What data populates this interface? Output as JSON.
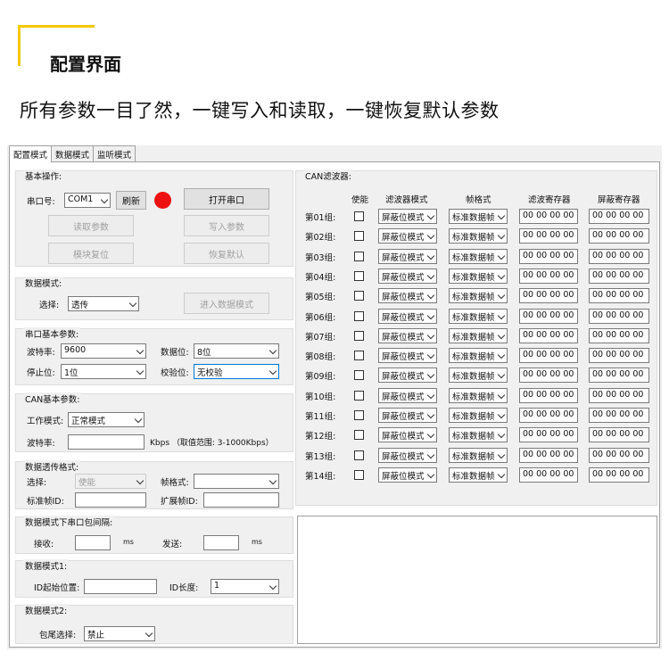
{
  "header": {
    "title": "配置界面",
    "subtitle": "所有参数一目了然，一键写入和读取，一键恢复默认参数"
  },
  "colors": {
    "accent": "#f5c800",
    "indicator": "#ee1111"
  },
  "tabs": [
    "配置模式",
    "数据模式",
    "监听模式"
  ],
  "basic_ops": {
    "label": "基本操作:",
    "port_label": "串口号:",
    "port_value": "COM1",
    "refresh": "刷新",
    "open_port": "打开串口",
    "read_params": "读取参数",
    "write_params": "写入参数",
    "module_reset": "模块复位",
    "restore_default": "恢复默认"
  },
  "data_mode": {
    "label": "数据模式:",
    "select_label": "选择:",
    "select_value": "透传",
    "enter_button": "进入数据模式"
  },
  "serial_params": {
    "label": "串口基本参数:",
    "baud_label": "波特率:",
    "baud_value": "9600",
    "databits_label": "数据位:",
    "databits_value": "8位",
    "stopbits_label": "停止位:",
    "stopbits_value": "1位",
    "parity_label": "校验位:",
    "parity_value": "无校验"
  },
  "can_params": {
    "label": "CAN基本参数:",
    "workmode_label": "工作模式:",
    "workmode_value": "正常模式",
    "baud_label": "波特率:",
    "baud_value": "",
    "baud_hint": "Kbps （取值范围: 3-1000Kbps）"
  },
  "transparent_format": {
    "label": "数据透传格式:",
    "select_label": "选择:",
    "select_value": "使能",
    "frame_label": "帧格式:",
    "frame_value": "",
    "std_id_label": "标准帧ID:",
    "std_id_value": "",
    "ext_id_label": "扩展帧ID:",
    "ext_id_value": ""
  },
  "packet_interval": {
    "label": "数据模式下串口包间隔:",
    "recv_label": "接收:",
    "recv_value": "",
    "recv_unit": "ms",
    "send_label": "发送:",
    "send_value": "",
    "send_unit": "ms"
  },
  "data_mode1": {
    "label": "数据模式1:",
    "start_label": "ID起始位置:",
    "start_value": "",
    "len_label": "ID长度:",
    "len_value": "1"
  },
  "data_mode2": {
    "label": "数据模式2:",
    "tail_label": "包尾选择:",
    "tail_value": "禁止"
  },
  "can_filter": {
    "label": "CAN滤波器:",
    "headers": [
      "使能",
      "滤波器模式",
      "帧格式",
      "滤波寄存器",
      "屏蔽寄存器"
    ],
    "rows": [
      {
        "name": "第01组:",
        "enabled": false,
        "mode": "屏蔽位模式",
        "frame": "标准数据帧",
        "filter": "00 00 00 00",
        "mask": "00 00 00 00"
      },
      {
        "name": "第02组:",
        "enabled": false,
        "mode": "屏蔽位模式",
        "frame": "标准数据帧",
        "filter": "00 00 00 00",
        "mask": "00 00 00 00"
      },
      {
        "name": "第03组:",
        "enabled": false,
        "mode": "屏蔽位模式",
        "frame": "标准数据帧",
        "filter": "00 00 00 00",
        "mask": "00 00 00 00"
      },
      {
        "name": "第04组:",
        "enabled": false,
        "mode": "屏蔽位模式",
        "frame": "标准数据帧",
        "filter": "00 00 00 00",
        "mask": "00 00 00 00"
      },
      {
        "name": "第05组:",
        "enabled": false,
        "mode": "屏蔽位模式",
        "frame": "标准数据帧",
        "filter": "00 00 00 00",
        "mask": "00 00 00 00"
      },
      {
        "name": "第06组:",
        "enabled": false,
        "mode": "屏蔽位模式",
        "frame": "标准数据帧",
        "filter": "00 00 00 00",
        "mask": "00 00 00 00"
      },
      {
        "name": "第07组:",
        "enabled": false,
        "mode": "屏蔽位模式",
        "frame": "标准数据帧",
        "filter": "00 00 00 00",
        "mask": "00 00 00 00"
      },
      {
        "name": "第08组:",
        "enabled": false,
        "mode": "屏蔽位模式",
        "frame": "标准数据帧",
        "filter": "00 00 00 00",
        "mask": "00 00 00 00"
      },
      {
        "name": "第09组:",
        "enabled": false,
        "mode": "屏蔽位模式",
        "frame": "标准数据帧",
        "filter": "00 00 00 00",
        "mask": "00 00 00 00"
      },
      {
        "name": "第10组:",
        "enabled": false,
        "mode": "屏蔽位模式",
        "frame": "标准数据帧",
        "filter": "00 00 00 00",
        "mask": "00 00 00 00"
      },
      {
        "name": "第11组:",
        "enabled": false,
        "mode": "屏蔽位模式",
        "frame": "标准数据帧",
        "filter": "00 00 00 00",
        "mask": "00 00 00 00"
      },
      {
        "name": "第12组:",
        "enabled": false,
        "mode": "屏蔽位模式",
        "frame": "标准数据帧",
        "filter": "00 00 00 00",
        "mask": "00 00 00 00"
      },
      {
        "name": "第13组:",
        "enabled": false,
        "mode": "屏蔽位模式",
        "frame": "标准数据帧",
        "filter": "00 00 00 00",
        "mask": "00 00 00 00"
      },
      {
        "name": "第14组:",
        "enabled": false,
        "mode": "屏蔽位模式",
        "frame": "标准数据帧",
        "filter": "00 00 00 00",
        "mask": "00 00 00 00"
      }
    ]
  }
}
